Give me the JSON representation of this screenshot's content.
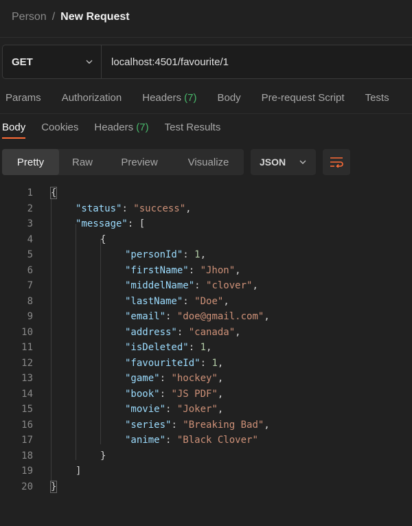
{
  "breadcrumb": {
    "parent": "Person",
    "separator": "/",
    "current": "New Request"
  },
  "request": {
    "method": "GET",
    "url": "localhost:4501/favourite/1"
  },
  "request_tabs": [
    {
      "label": "Params"
    },
    {
      "label": "Authorization"
    },
    {
      "label": "Headers",
      "count": "(7)"
    },
    {
      "label": "Body"
    },
    {
      "label": "Pre-request Script"
    },
    {
      "label": "Tests"
    }
  ],
  "response_tabs": {
    "body": "Body",
    "cookies": "Cookies",
    "headers": "Headers",
    "headers_count": "(7)",
    "test_results": "Test Results"
  },
  "view_modes": {
    "pretty": "Pretty",
    "raw": "Raw",
    "preview": "Preview",
    "visualize": "Visualize"
  },
  "language": "JSON",
  "colors": {
    "accent": "#ff6c37",
    "count_green": "#49b86b",
    "key": "#9cdcfe",
    "string": "#ce9178",
    "number": "#b5cea8"
  },
  "response": {
    "status": "success",
    "message": [
      {
        "personId": 1,
        "firstName": "Jhon",
        "middelName": "clover",
        "lastName": "Doe",
        "email": "doe@gmail.com",
        "address": "canada",
        "isDeleted": 1,
        "favouriteId": 1,
        "game": "hockey",
        "book": "JS PDF",
        "movie": "Joker",
        "series": "Breaking Bad",
        "anime": "Black Clover"
      }
    ]
  }
}
